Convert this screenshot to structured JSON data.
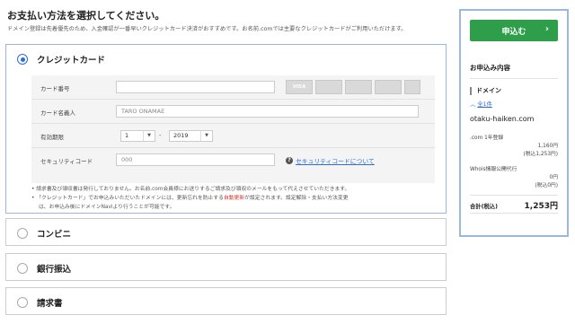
{
  "page": {
    "title": "お支払い方法を選択してください。",
    "subtitle": "ドメイン登録は先着優先のため、入金確認が一番早いクレジットカード決済がおすすめです。お名前.comでは主要なクレジットカードがご利用いただけます。"
  },
  "credit": {
    "label": "クレジットカード",
    "selected": true,
    "card_number_label": "カード番号",
    "card_number_value": "",
    "holder_label": "カード名義人",
    "holder_placeholder": "TARO ONAMAE",
    "expiry_label": "有効期限",
    "expiry_month": "1",
    "expiry_sep": "-",
    "expiry_year": "2019",
    "security_label": "セキュリティコード",
    "security_placeholder": "000",
    "security_help": "セキュリティコードについて",
    "card_brands": [
      "VISA",
      "Mastercard",
      "JCB",
      "Diners Club",
      "American Express"
    ],
    "note1": "• 請求書及び領収書は発行しておりません。お名前.com会員様にお送りするご請求及び領収のメールをもって代えさせていただきます。",
    "note2_a": "• 「クレジットカード」でお申込みいただいたドメインには、更新忘れを防止する",
    "note2_red": "自動更新",
    "note2_b": "が設定されます。設定解除・支払い方法変更",
    "note3": "は、お申込み後にドメインNaviより行うことが可能です。"
  },
  "options": [
    {
      "label": "コンビニ"
    },
    {
      "label": "銀行振込"
    },
    {
      "label": "請求書"
    }
  ],
  "summary": {
    "apply_label": "申込む",
    "title": "お申込み内容",
    "section": "ドメイン",
    "collapse_label": "全1件",
    "domain": "otaku-haiken.com",
    "item1_label": ".com 1年登録",
    "item1_price": "1,160円",
    "item1_tax": "(税込1,253円)",
    "item2_label": "Whois情報公開代行",
    "item2_price": "0円",
    "item2_tax": "(税込0円)",
    "total_label": "合計(税込)",
    "total_value": "1,253円"
  },
  "colors": {
    "accent": "#2b6ed8",
    "apply_button": "#2e9e4a",
    "highlight_border": "#9cb5e3",
    "warning_red": "#d9302b"
  }
}
